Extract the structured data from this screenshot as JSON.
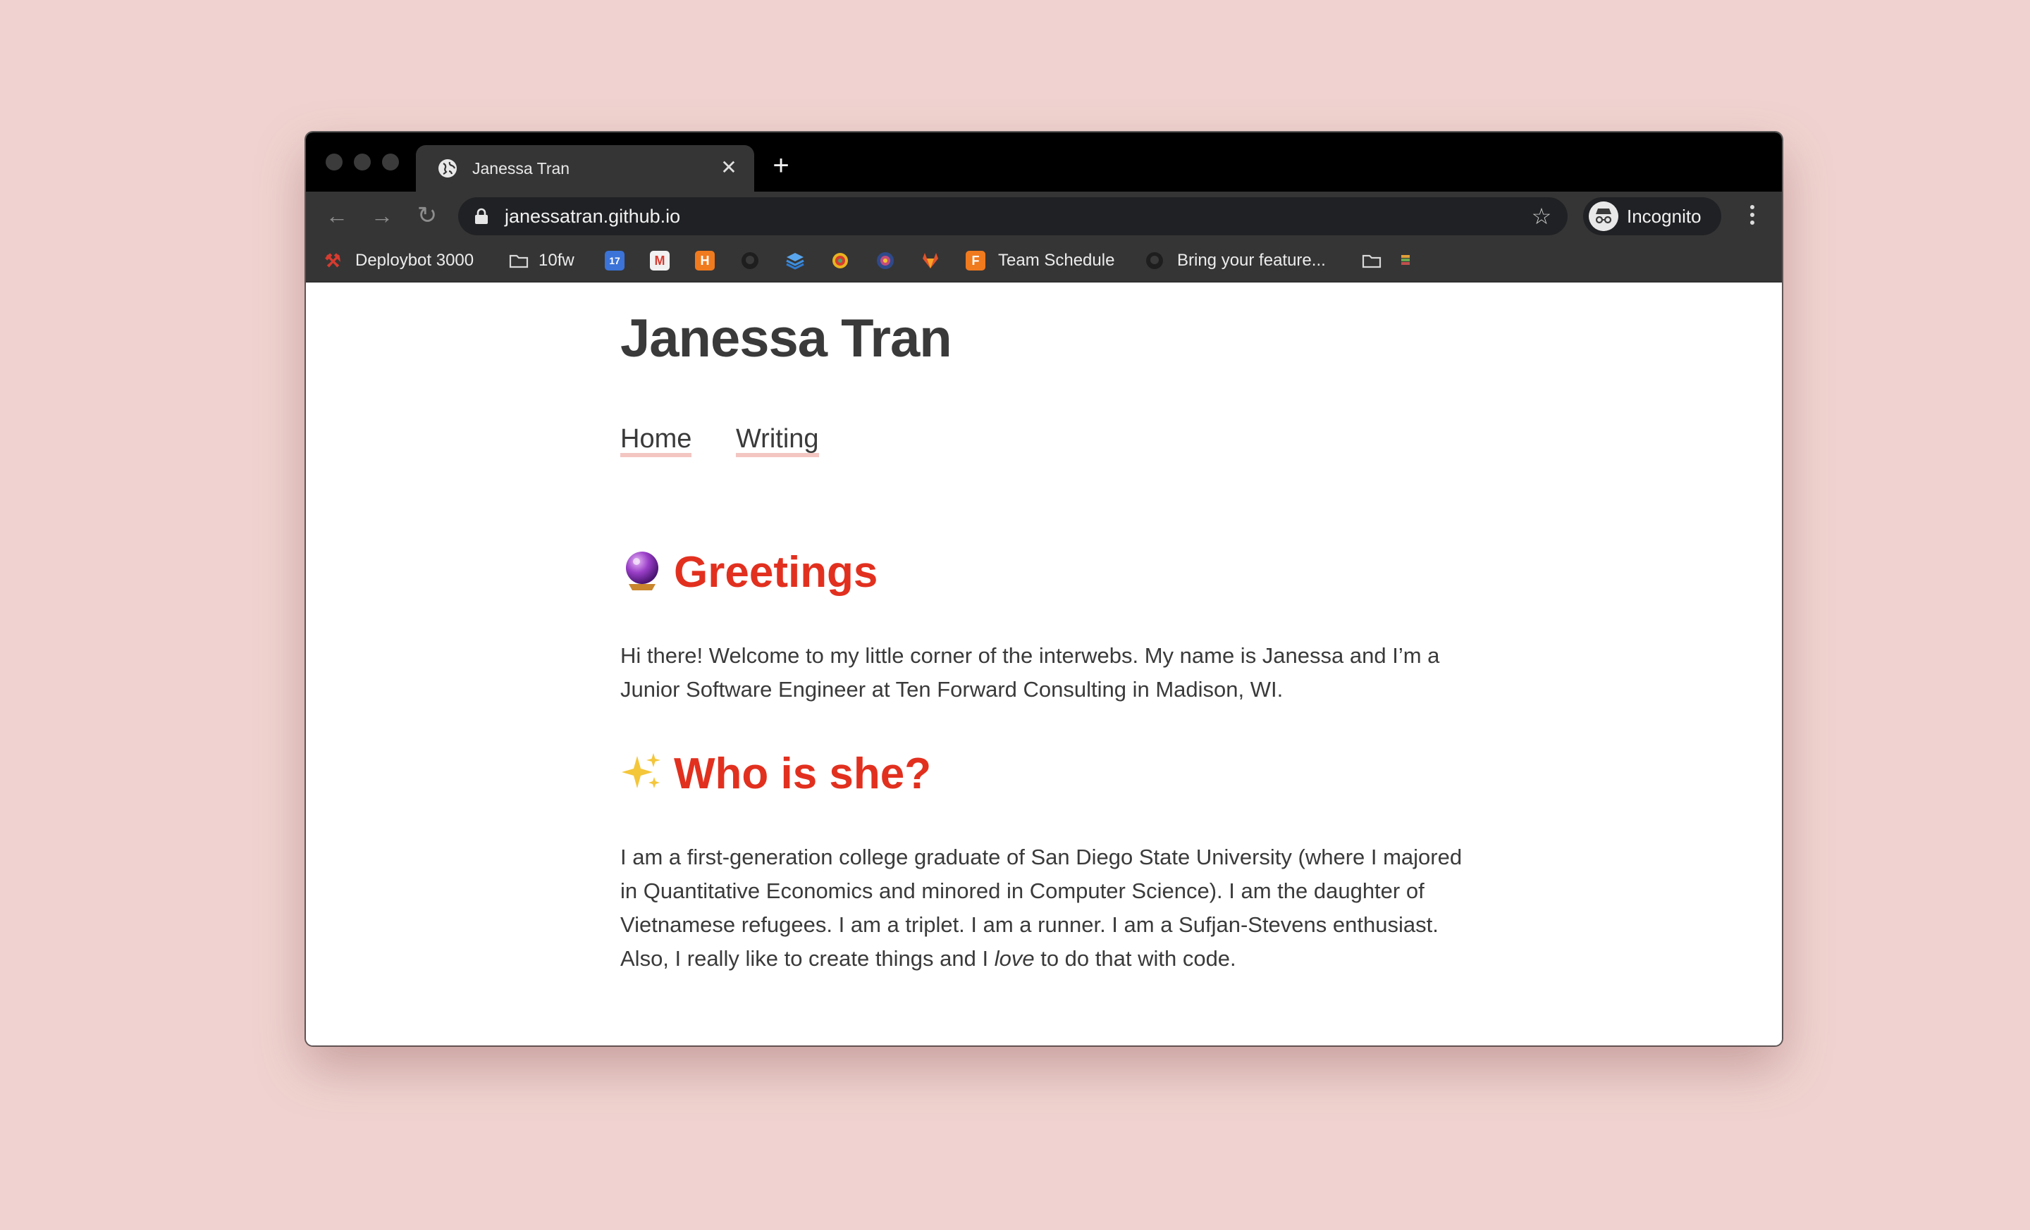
{
  "browser": {
    "tab_title": "Janessa Tran",
    "url": "janessatran.github.io",
    "profile_label": "Incognito",
    "bookmarks": [
      {
        "label": "Deploybot 3000",
        "icon": "hammer-icon",
        "color": "#d83b2f"
      },
      {
        "label": "10fw",
        "icon": "folder-icon",
        "color": "#cfcfcf"
      },
      {
        "label": "",
        "icon": "calendar-icon",
        "color": "#3b73d8",
        "glyph": "17"
      },
      {
        "label": "",
        "icon": "gmail-icon",
        "color": "#d63c30",
        "glyph": "M"
      },
      {
        "label": "",
        "icon": "harvest-icon",
        "color": "#f07a1e",
        "glyph": "H"
      },
      {
        "label": "",
        "icon": "github-icon",
        "color": "#2a2a2a",
        "glyph": ""
      },
      {
        "label": "",
        "icon": "layers-icon",
        "color": "#3c8fe0",
        "glyph": ""
      },
      {
        "label": "",
        "icon": "slack-icon",
        "color": "#e8b320",
        "glyph": ""
      },
      {
        "label": "",
        "icon": "circleci-icon",
        "color": "#c44d7a",
        "glyph": ""
      },
      {
        "label": "",
        "icon": "gitlab-icon",
        "color": "#e2532a",
        "glyph": ""
      },
      {
        "label": "Team Schedule",
        "icon": "forecast-icon",
        "color": "#f07a1e",
        "glyph": "F"
      },
      {
        "label": "Bring your feature...",
        "icon": "github-icon",
        "color": "#2a2a2a",
        "glyph": ""
      },
      {
        "label": "",
        "icon": "folder-icon",
        "color": "#cfcfcf"
      },
      {
        "label": "",
        "icon": "books-icon",
        "color": "#6aa84f"
      }
    ]
  },
  "site": {
    "title": "Janessa Tran",
    "nav": [
      "Home",
      "Writing"
    ],
    "sections": [
      {
        "emoji": "crystal-ball-icon",
        "heading": "Greetings",
        "body": "Hi there! Welcome to my little corner of the interwebs. My name is Janessa and I’m a Junior Software Engineer at Ten Forward Consulting in Madison, WI."
      },
      {
        "emoji": "sparkles-icon",
        "heading": "Who is she?",
        "body_before": "I am a first-generation college graduate of San Diego State University (where I majored in Quantitative Economics and minored in Computer Science). I am the daughter of Vietnamese refugees. I am a triplet. I am a runner. I am a Sufjan-Stevens enthusiast. Also, I really like to create things and I ",
        "body_em": "love",
        "body_after": " to do that with code."
      }
    ]
  },
  "colors": {
    "background": "#f0d3d0",
    "heading_accent": "#e2301f",
    "nav_underline": "#f3c6c2"
  }
}
